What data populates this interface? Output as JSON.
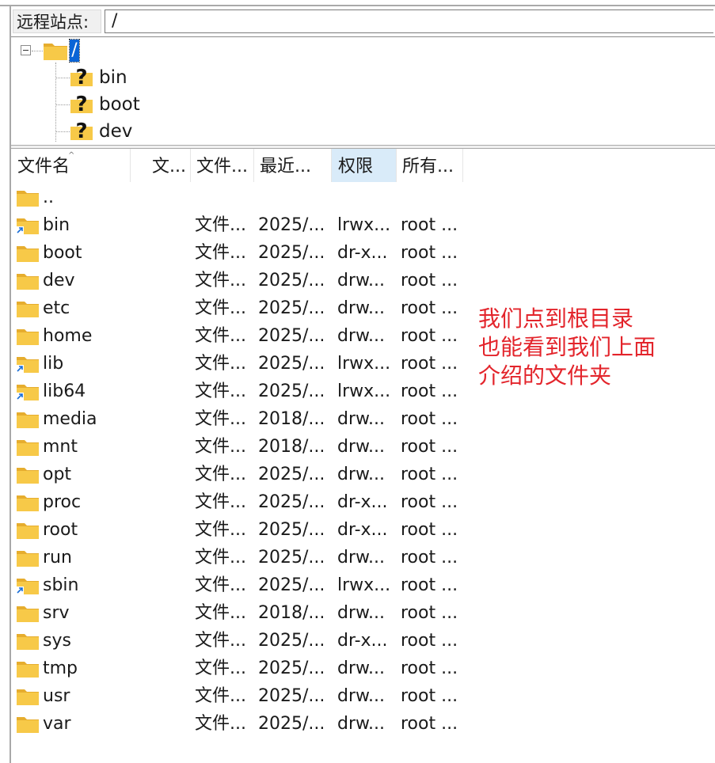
{
  "remote_site": {
    "label": "远程站点:",
    "path": "/"
  },
  "tree": {
    "root_label": "/",
    "children": [
      {
        "name": "bin",
        "icon": "unknown-folder-icon"
      },
      {
        "name": "boot",
        "icon": "unknown-folder-icon"
      },
      {
        "name": "dev",
        "icon": "unknown-folder-icon"
      }
    ]
  },
  "list": {
    "columns": [
      {
        "label": "文件名"
      },
      {
        "label": "文..."
      },
      {
        "label": "文件..."
      },
      {
        "label": "最近..."
      },
      {
        "label": "权限"
      },
      {
        "label": "所有..."
      }
    ],
    "sorted_column": "文件名",
    "rows": [
      {
        "name": "..",
        "size": "",
        "type": "",
        "modified": "",
        "perms": "",
        "owner": "",
        "link": false
      },
      {
        "name": "bin",
        "size": "",
        "type": "文件...",
        "modified": "2025/...",
        "perms": "lrwx...",
        "owner": "root ...",
        "link": true
      },
      {
        "name": "boot",
        "size": "",
        "type": "文件...",
        "modified": "2025/...",
        "perms": "dr-x...",
        "owner": "root ...",
        "link": false
      },
      {
        "name": "dev",
        "size": "",
        "type": "文件...",
        "modified": "2025/...",
        "perms": "drw...",
        "owner": "root ...",
        "link": false
      },
      {
        "name": "etc",
        "size": "",
        "type": "文件...",
        "modified": "2025/...",
        "perms": "drw...",
        "owner": "root ...",
        "link": false
      },
      {
        "name": "home",
        "size": "",
        "type": "文件...",
        "modified": "2025/...",
        "perms": "drw...",
        "owner": "root ...",
        "link": false
      },
      {
        "name": "lib",
        "size": "",
        "type": "文件...",
        "modified": "2025/...",
        "perms": "lrwx...",
        "owner": "root ...",
        "link": true
      },
      {
        "name": "lib64",
        "size": "",
        "type": "文件...",
        "modified": "2025/...",
        "perms": "lrwx...",
        "owner": "root ...",
        "link": true
      },
      {
        "name": "media",
        "size": "",
        "type": "文件...",
        "modified": "2018/...",
        "perms": "drw...",
        "owner": "root ...",
        "link": false
      },
      {
        "name": "mnt",
        "size": "",
        "type": "文件...",
        "modified": "2018/...",
        "perms": "drw...",
        "owner": "root ...",
        "link": false
      },
      {
        "name": "opt",
        "size": "",
        "type": "文件...",
        "modified": "2025/...",
        "perms": "drw...",
        "owner": "root ...",
        "link": false
      },
      {
        "name": "proc",
        "size": "",
        "type": "文件...",
        "modified": "2025/...",
        "perms": "dr-x...",
        "owner": "root ...",
        "link": false
      },
      {
        "name": "root",
        "size": "",
        "type": "文件...",
        "modified": "2025/...",
        "perms": "dr-x...",
        "owner": "root ...",
        "link": false
      },
      {
        "name": "run",
        "size": "",
        "type": "文件...",
        "modified": "2025/...",
        "perms": "drw...",
        "owner": "root ...",
        "link": false
      },
      {
        "name": "sbin",
        "size": "",
        "type": "文件...",
        "modified": "2025/...",
        "perms": "lrwx...",
        "owner": "root ...",
        "link": true
      },
      {
        "name": "srv",
        "size": "",
        "type": "文件...",
        "modified": "2018/...",
        "perms": "drw...",
        "owner": "root ...",
        "link": false
      },
      {
        "name": "sys",
        "size": "",
        "type": "文件...",
        "modified": "2025/...",
        "perms": "dr-x...",
        "owner": "root ...",
        "link": false
      },
      {
        "name": "tmp",
        "size": "",
        "type": "文件...",
        "modified": "2025/...",
        "perms": "drw...",
        "owner": "root ...",
        "link": false
      },
      {
        "name": "usr",
        "size": "",
        "type": "文件...",
        "modified": "2025/...",
        "perms": "drw...",
        "owner": "root ...",
        "link": false
      },
      {
        "name": "var",
        "size": "",
        "type": "文件...",
        "modified": "2025/...",
        "perms": "drw...",
        "owner": "root ...",
        "link": false
      }
    ]
  },
  "annotation": {
    "lines": [
      "我们点到根目录",
      "也能看到我们上面",
      "介绍的文件夹"
    ],
    "color": "#e3242b"
  },
  "colors": {
    "folder_yellow": "#f7c948",
    "selection_blue": "#0a64d6",
    "sorted_header": "#d9ebf9"
  }
}
